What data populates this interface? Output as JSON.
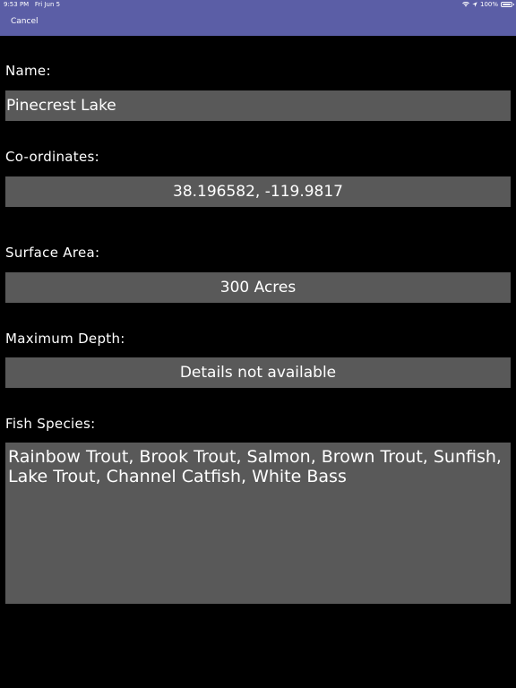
{
  "status_bar": {
    "time": "9:53 PM",
    "date": "Fri Jun 5",
    "battery": "100%"
  },
  "nav": {
    "cancel_label": "Cancel"
  },
  "form": {
    "name_label": "Name:",
    "name_value": "Pinecrest Lake",
    "coordinates_label": "Co-ordinates:",
    "coordinates_value": "38.196582, -119.9817",
    "surface_area_label": "Surface Area:",
    "surface_area_value": "300 Acres",
    "max_depth_label": "Maximum Depth:",
    "max_depth_value": "Details not available",
    "fish_species_label": "Fish Species:",
    "fish_species_value": "Rainbow Trout, Brook Trout, Salmon, Brown Trout, Sunfish, Lake Trout, Channel Catfish, White Bass"
  },
  "colors": {
    "nav_bar": "#5b5ea6",
    "background": "#000000",
    "field_background": "#595959",
    "text": "#ffffff"
  }
}
